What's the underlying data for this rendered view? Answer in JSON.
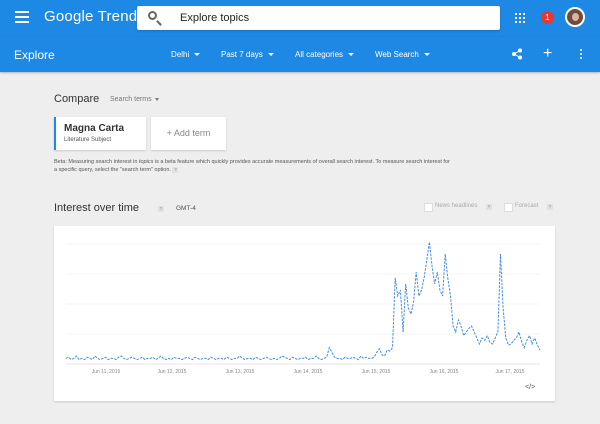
{
  "header": {
    "brand": "Google Trends",
    "search_placeholder": "Explore topics",
    "notification_count": "1"
  },
  "subbar": {
    "title": "Explore",
    "filters": [
      "Delhi",
      "Past 7 days",
      "All categories",
      "Web Search"
    ]
  },
  "compare": {
    "title": "Compare",
    "search_terms_label": "Search terms",
    "term": {
      "name": "Magna Carta",
      "type": "Literature Subject"
    },
    "add_term": "+ Add term",
    "beta_note_1": "Beta: Measuring search interest in ",
    "beta_note_italic": "topics",
    "beta_note_2": " is a beta feature which quickly provides accurate measurements of overall search interest. To measure search interest for a specific query, select the \"search term\" option."
  },
  "interest": {
    "title": "Interest over time",
    "timezone": "GMT-4",
    "news_headlines_label": "News headlines",
    "forecast_label": "Forecast",
    "help": "?"
  },
  "chart_data": {
    "type": "line",
    "x_ticks": [
      "Jun 11, 2015",
      "Jun 12, 2015",
      "Jun 13, 2015",
      "Jun 14, 2015",
      "Jun 15, 2015",
      "Jun 16, 2015",
      "Jun 17, 2015"
    ],
    "ylim": [
      0,
      100
    ],
    "grid": true,
    "series": [
      {
        "color": "#4a8bdc",
        "values": [
          3,
          4,
          2,
          3,
          5,
          2,
          3,
          2,
          4,
          3,
          2,
          5,
          3,
          2,
          3,
          4,
          2,
          3,
          3,
          2,
          4,
          5,
          3,
          2,
          3,
          4,
          3,
          2,
          3,
          4,
          2,
          3,
          3,
          4,
          2,
          3,
          5,
          3,
          2,
          3,
          2,
          4,
          3,
          3,
          2,
          3,
          4,
          3,
          2,
          4,
          3,
          2,
          3,
          3,
          2,
          4,
          3,
          2,
          3,
          3,
          2,
          4,
          3,
          2,
          3,
          3,
          5,
          3,
          2,
          3,
          3,
          2,
          4,
          3,
          2,
          3,
          4,
          3,
          2,
          3,
          2,
          3,
          5,
          4,
          3,
          2,
          4,
          3,
          2,
          3,
          3,
          4,
          2,
          3,
          3,
          5,
          3,
          2,
          3,
          4,
          12,
          8,
          4,
          3,
          3,
          2,
          4,
          3,
          3,
          4,
          3,
          2,
          5,
          3,
          4,
          3,
          3,
          4,
          8,
          11,
          6,
          5,
          10,
          9,
          12,
          70,
          55,
          60,
          25,
          65,
          45,
          40,
          50,
          75,
          55,
          60,
          70,
          85,
          100,
          80,
          65,
          75,
          60,
          55,
          90,
          70,
          55,
          30,
          25,
          35,
          30,
          22,
          25,
          28,
          30,
          25,
          20,
          15,
          20,
          18,
          22,
          16,
          15,
          20,
          25,
          90,
          45,
          20,
          14,
          15,
          18,
          20,
          25,
          17,
          12,
          18,
          22,
          15,
          20,
          14,
          10
        ]
      }
    ],
    "xlabel": "",
    "ylabel": ""
  },
  "footer": {
    "embed": "</>"
  }
}
